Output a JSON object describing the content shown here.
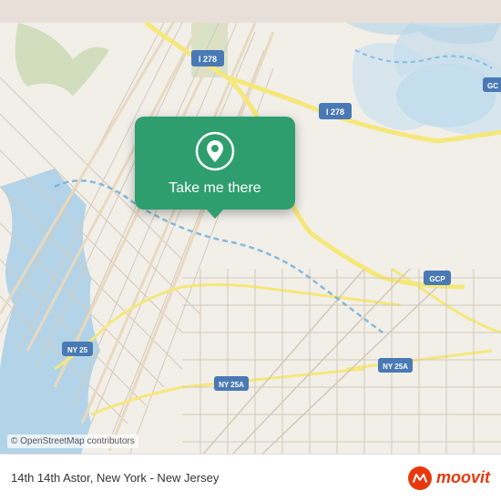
{
  "map": {
    "copyright": "© OpenStreetMap contributors",
    "location_label": "14th 14th Astor, New York - New Jersey",
    "popup": {
      "button_label": "Take me there"
    },
    "highway_labels": [
      "I 278",
      "I 278",
      "NY 25",
      "NY 25A",
      "NY 25A",
      "NY 25A",
      "GCP",
      "GC"
    ],
    "accent_color": "#2e9e6e",
    "moovit": {
      "logo_text": "moovit"
    }
  }
}
